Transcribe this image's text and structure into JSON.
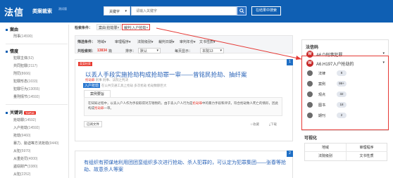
{
  "header": {
    "logo": "法信",
    "subtitle": "类案裁索",
    "beta": "测试版",
    "search_select": "关键字",
    "search_placeholder": "请输入关键字",
    "search_icon": "search-icon",
    "refine_button": "在结果中搜索"
  },
  "sidebar": {
    "sections": [
      {
        "title": "案由",
        "items": [
          {
            "label": "刑事",
            "count": "(14590)"
          }
        ]
      },
      {
        "title": "情度",
        "items": [
          {
            "label": "犯罪主体",
            "count": "(52)"
          },
          {
            "label": "共同犯罪",
            "count": "(2117)"
          },
          {
            "label": "刑罚",
            "count": "(8666)"
          },
          {
            "label": "犯罪形态",
            "count": "(1033)"
          },
          {
            "label": "犯罪行为",
            "count": "(13055)"
          },
          {
            "label": "量刑情节",
            "count": "(14592)"
          }
        ]
      },
      {
        "title": "关键词",
        "badge": "TOP10",
        "items": [
          {
            "label": "抢劫罪",
            "count": "(14592)"
          },
          {
            "label": "入户抢劫",
            "count": "(14592)"
          },
          {
            "label": "抢劫",
            "count": "(9460)"
          },
          {
            "label": "暴力、胁迫等方法抢劫",
            "count": "(9440)"
          },
          {
            "label": "从犯",
            "count": "(5970)"
          },
          {
            "label": "从重处罚",
            "count": "(4000)"
          },
          {
            "label": "盗窃财产",
            "count": "(3380)"
          },
          {
            "label": "从犯",
            "count": "(2252)"
          }
        ]
      }
    ]
  },
  "filters": {
    "search_label": "检索条件：",
    "chip1": "案由:抢劫罪",
    "chip2": "裁判:入户抢劫",
    "chip_close": "×",
    "row1_label": "筛选条件：",
    "row1": [
      "地域",
      "审理程序",
      "法院级别",
      "裁判日期",
      "审判年份",
      "文书性质"
    ],
    "row2_label": "共检索到：",
    "row2_count": "13834",
    "row2_unit": "篇",
    "sort_label": "排序：",
    "sort_value": "默认",
    "display_label": "每页显示：",
    "display_value": "本院13",
    "down_caret": "▾"
  },
  "results": [
    {
      "index": "1",
      "tag": "类案检索",
      "title": "以丢人手段实施抢劫构成抢劫罪一审——曾铭民抢劫、抽纤案",
      "meta_a": "抢劫罪",
      "meta_b": "刑事",
      "meta_c": "刑事、法院之判决",
      "highlight": "入户抢劫",
      "links": "在公共交通工具上抢劫 多次抢劫 抢劫数额巨大",
      "tab": "案例要旨",
      "abstract_a": "在知知过程中，以丢入户人作为手段取得对方钱物的，由于丢入户人行为是",
      "abstract_hl": "抢劫罪",
      "abstract_b": "中的暴力手段和评识，符合抢劫致人死亡的情形，因此构成",
      "abstract_hl2": "抢劫罪",
      "abstract_c": "一审。",
      "button": "已阅文件",
      "act1": "收藏",
      "act2": "下载"
    },
    {
      "index": "2",
      "title": "有组织有预谋地利用团团蛮组织多次进行抢劫、杀人犯罪的，可认定为犯罪集团——张春等抢劫、故意杀人等案"
    }
  ],
  "right_panel": {
    "title": "法信码",
    "law1": "A6.D刑事犯罪",
    "law2": "A6.H197入户抢劫的",
    "law_icon_letter": "W",
    "caret": "▾",
    "stats": [
      {
        "label": "法律",
        "count": "8",
        "icon": "law-icon"
      },
      {
        "label": "案例",
        "count": "99+",
        "icon": "case-icon"
      },
      {
        "label": "观点",
        "count": "32",
        "icon": "view-icon"
      },
      {
        "label": "图书",
        "count": "18",
        "icon": "book-icon"
      },
      {
        "label": "期刊",
        "count": "2",
        "icon": "journal-icon"
      }
    ],
    "viz_title": "可视化",
    "viz": [
      "地域",
      "审理程序",
      "法院级别",
      "文书性质"
    ]
  },
  "colors": {
    "brand": "#0f5fb3",
    "accent_red": "#e53935",
    "link_blue": "#2b64b8"
  }
}
